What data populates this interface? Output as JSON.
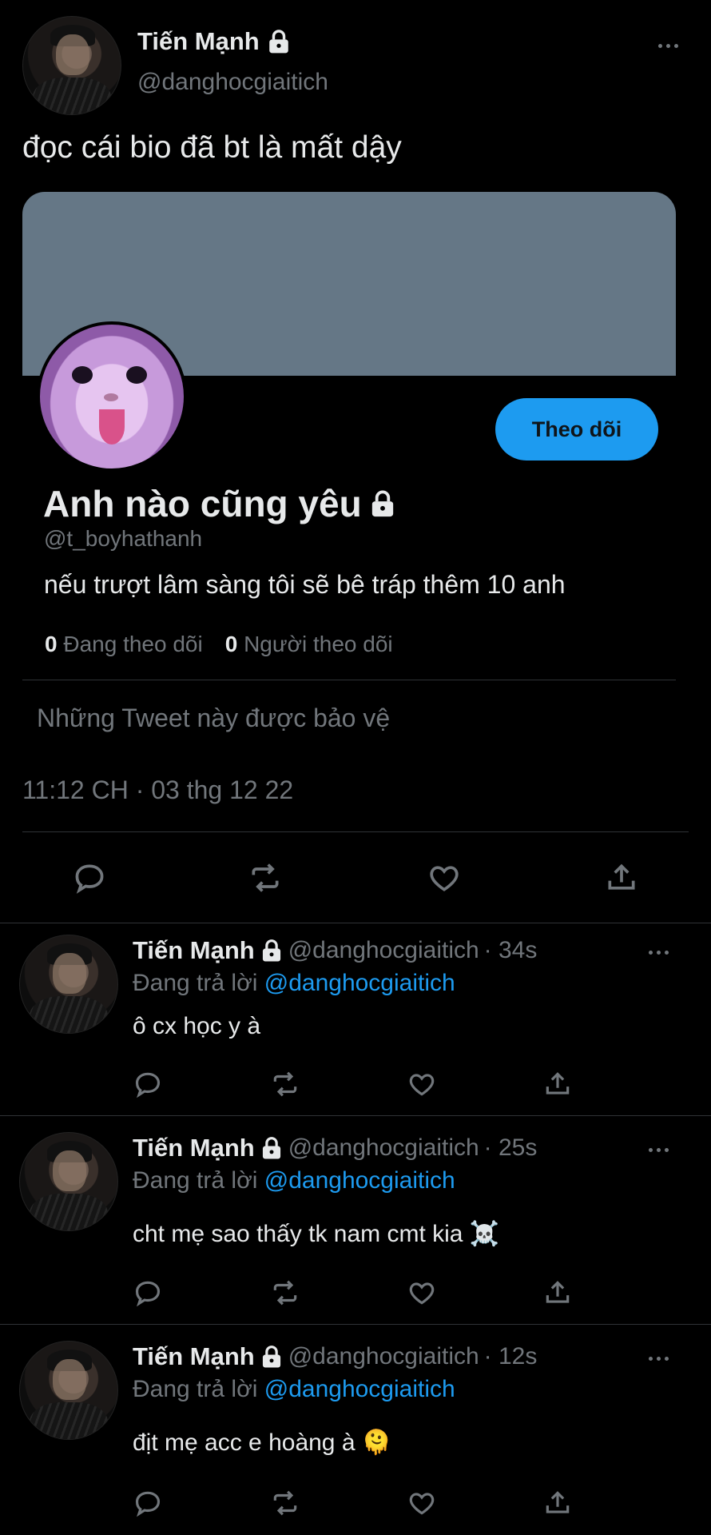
{
  "main_tweet": {
    "author_name": "Tiến Mạnh",
    "author_handle": "@danghocgiaitich",
    "text": "đọc cái bio đã bt là mất dậy",
    "timestamp": "11:12 CH · 03 thg 12 22"
  },
  "profile_card": {
    "banner_color": "#657786",
    "follow_button": "Theo dõi",
    "name": "Anh nào cũng yêu",
    "handle": "@t_boyhathanh",
    "bio": "nếu trượt lâm sàng tôi sẽ bê tráp thêm 10 anh",
    "following_count": "0",
    "following_label": "Đang theo dõi",
    "followers_count": "0",
    "followers_label": "Người theo dõi",
    "protected_text": "Những Tweet này được bảo vệ"
  },
  "replies": [
    {
      "author_name": "Tiến Mạnh",
      "author_handle": "@danghocgiaitich",
      "time": "· 34s",
      "replying_prefix": "Đang trả lời",
      "replying_to": "@danghocgiaitich",
      "text": "ô cx học y à"
    },
    {
      "author_name": "Tiến Mạnh",
      "author_handle": "@danghocgiaitich",
      "time": "· 25s",
      "replying_prefix": "Đang trả lời",
      "replying_to": "@danghocgiaitich",
      "text": "cht mẹ sao thấy tk nam cmt kia ☠️"
    },
    {
      "author_name": "Tiến Mạnh",
      "author_handle": "@danghocgiaitich",
      "time": "· 12s",
      "replying_prefix": "Đang trả lời",
      "replying_to": "@danghocgiaitich",
      "text": "địt mẹ acc e hoàng à 🫠"
    }
  ],
  "colors": {
    "accent": "#1d9bf0",
    "background": "#000000",
    "muted": "#71767b"
  },
  "icons": [
    "lock-icon",
    "more-icon",
    "reply-icon",
    "retweet-icon",
    "like-icon",
    "share-icon"
  ]
}
